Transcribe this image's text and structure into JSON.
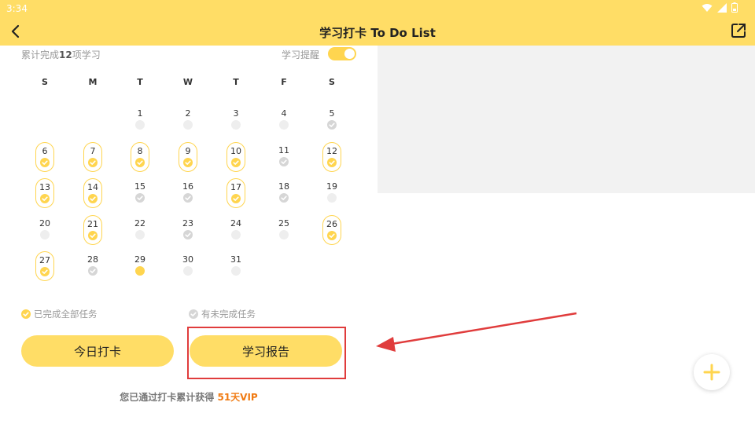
{
  "status_bar": {
    "time": "3:34"
  },
  "app_bar": {
    "title": "学习打卡 To Do List",
    "back_icon": "back-arrow-icon",
    "share_icon": "share-icon"
  },
  "summary": {
    "prefix": "累计完成",
    "count": "12",
    "suffix": "项学习"
  },
  "reminder": {
    "label": "学习提醒",
    "enabled": true
  },
  "calendar": {
    "weekdays": [
      "S",
      "M",
      "T",
      "W",
      "T",
      "F",
      "S"
    ],
    "days": [
      {
        "n": "1",
        "s": "empty"
      },
      {
        "n": "2",
        "s": "empty"
      },
      {
        "n": "3",
        "s": "empty"
      },
      {
        "n": "4",
        "s": "empty"
      },
      {
        "n": "5",
        "s": "partial"
      },
      {
        "n": "6",
        "s": "done"
      },
      {
        "n": "7",
        "s": "done"
      },
      {
        "n": "8",
        "s": "done"
      },
      {
        "n": "9",
        "s": "done"
      },
      {
        "n": "10",
        "s": "done"
      },
      {
        "n": "11",
        "s": "partial"
      },
      {
        "n": "12",
        "s": "done"
      },
      {
        "n": "13",
        "s": "done"
      },
      {
        "n": "14",
        "s": "done"
      },
      {
        "n": "15",
        "s": "partial"
      },
      {
        "n": "16",
        "s": "partial"
      },
      {
        "n": "17",
        "s": "done"
      },
      {
        "n": "18",
        "s": "partial"
      },
      {
        "n": "19",
        "s": "empty"
      },
      {
        "n": "20",
        "s": "empty"
      },
      {
        "n": "21",
        "s": "done"
      },
      {
        "n": "22",
        "s": "empty"
      },
      {
        "n": "23",
        "s": "partial"
      },
      {
        "n": "24",
        "s": "empty"
      },
      {
        "n": "25",
        "s": "empty"
      },
      {
        "n": "26",
        "s": "done"
      },
      {
        "n": "27",
        "s": "done"
      },
      {
        "n": "28",
        "s": "partial"
      },
      {
        "n": "29",
        "s": "today"
      },
      {
        "n": "30",
        "s": "empty"
      },
      {
        "n": "31",
        "s": "empty"
      }
    ]
  },
  "legend": {
    "done_label": "已完成全部任务",
    "partial_label": "有未完成任务"
  },
  "buttons": {
    "checkin_label": "今日打卡",
    "report_label": "学习报告"
  },
  "vip_line": {
    "prefix": "您已通过打卡累计获得 ",
    "highlight": "51天VIP"
  },
  "fab": {
    "icon": "plus-icon"
  },
  "colors": {
    "accent": "#FFDD66",
    "check_yellow": "#FFD54F",
    "check_gray": "#D6D6D6",
    "vip_orange": "#F07A12",
    "annotation_red": "#E03C3C"
  }
}
